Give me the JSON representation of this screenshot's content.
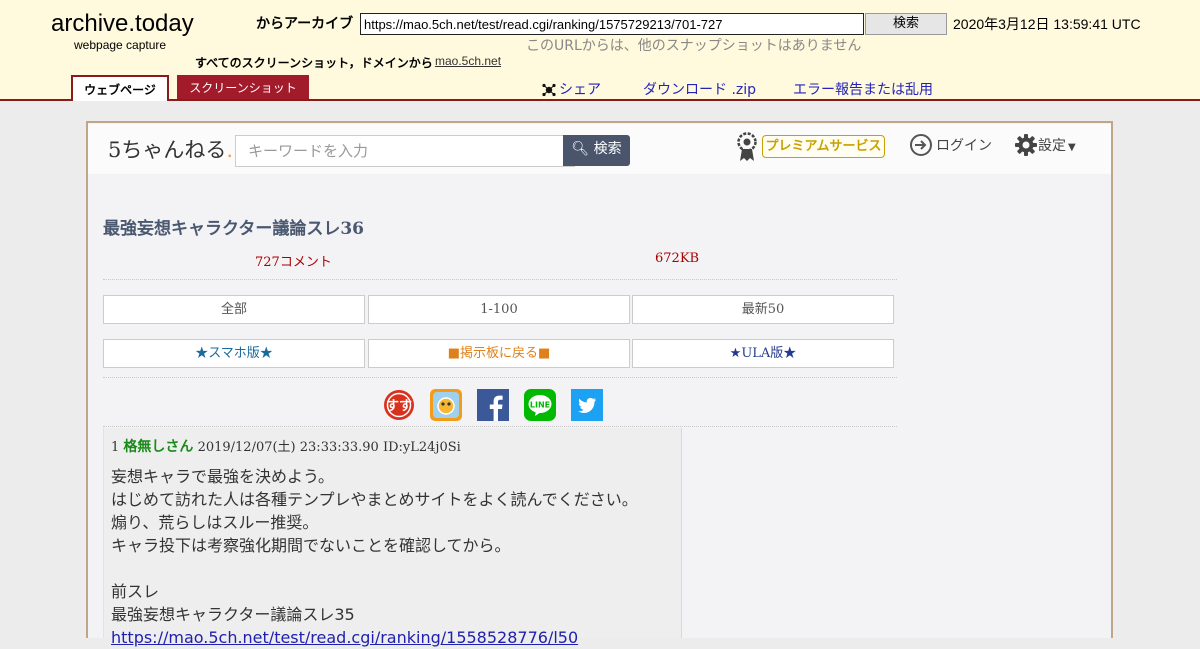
{
  "archive": {
    "brand": "archive.today",
    "brand_sub": "webpage capture",
    "from_label": "からアーカイブ",
    "url": "https://mao.5ch.net/test/read.cgi/ranking/1575729213/701-727",
    "search_label": "検索",
    "capture_date": "2020年3月12日 13:59:41 UTC",
    "no_snapshots": "このURLからは、他のスナップショットはありません",
    "all_screenshots": "すべてのスクリーンショット，ドメインから",
    "domain": "mao.5ch.net",
    "tabs": [
      {
        "label": "ウェブページ",
        "active": true
      },
      {
        "label": "スクリーンショット",
        "active": false
      }
    ],
    "share": "シェア",
    "download": "ダウンロード .zip",
    "report": "エラー報告または乱用"
  },
  "site": {
    "logo": "5ちゃんねる",
    "search_placeholder": "キーワードを入力",
    "search_button": "検索",
    "premium": "プレミアムサービス",
    "login": "ログイン",
    "settings": "設定"
  },
  "thread": {
    "title": "最強妄想キャラクター議論スレ36",
    "comments": "727コメント",
    "size": "672KB",
    "nav": [
      "全部",
      "1-100",
      "最新50"
    ],
    "links": [
      "★スマホ版★",
      "■掲示板に戻る■",
      "★ULA版★"
    ],
    "share_icons": [
      "sumasuma-icon",
      "orange-app-icon",
      "facebook-icon",
      "line-icon",
      "twitter-icon"
    ]
  },
  "post": {
    "number": "1",
    "name": "格無しさん",
    "datetime": "2019/12/07(土) 23:33:33.90 ID:yL24j0Si",
    "lines": [
      "妄想キャラで最強を決めよう。",
      "はじめて訪れた人は各種テンプレやまとめサイトをよく読んでください。",
      "煽り、荒らしはスルー推奨。",
      "キャラ投下は考察強化期間でないことを確認してから。",
      "",
      "前スレ",
      "最強妄想キャラクター議論スレ35"
    ],
    "link": "https://mao.5ch.net/test/read.cgi/ranking/1558528776/l50"
  },
  "colors": {
    "archive_bg": "#fff9dd",
    "archive_accent": "#8b1a1a",
    "tab_red": "#a11b2b",
    "title_color": "#4a5870",
    "count_color": "#aa0000",
    "name_green": "#1a8a1a"
  }
}
